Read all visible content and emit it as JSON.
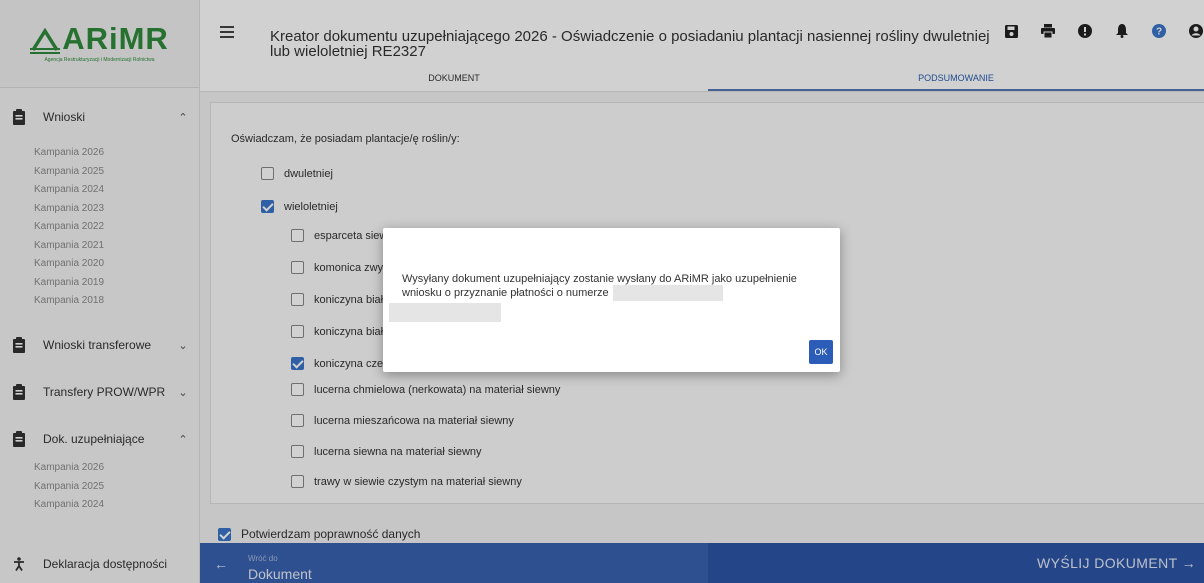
{
  "logo": {
    "text": "ARiMR",
    "subtitle": "Agencja Restrukturyzacji i Modernizacji Rolnictwa"
  },
  "header": {
    "title": "Kreator dokumentu uzupełniającego 2026 - Oświadczenie o posiadaniu plantacji nasiennej rośliny dwuletniej lub wieloletniej RE2327",
    "tabs": [
      "DOKUMENT",
      "PODSUMOWANIE"
    ],
    "icons": [
      "save-icon",
      "print-icon",
      "info-icon",
      "bell-icon",
      "help-icon",
      "user-icon"
    ]
  },
  "sidebar": {
    "sections": [
      {
        "label": "Wnioski",
        "chevron": "^",
        "items": [
          "Kampania 2026",
          "Kampania 2025",
          "Kampania 2024",
          "Kampania 2023",
          "Kampania 2022",
          "Kampania 2021",
          "Kampania 2020",
          "Kampania 2019",
          "Kampania 2018"
        ]
      },
      {
        "label": "Wnioski transferowe",
        "chevron": "v",
        "items": []
      },
      {
        "label": "Transfery PROW/WPR",
        "chevron": "v",
        "items": []
      },
      {
        "label": "Dok. uzupełniające",
        "chevron": "^",
        "items": [
          "Kampania 2026",
          "Kampania 2025",
          "Kampania 2024"
        ]
      }
    ],
    "footer": "Deklaracja dostępności"
  },
  "form": {
    "lead": "Oświadczam, że posiadam plantacje/ę roślin/y:",
    "types": [
      {
        "label": "dwuletniej",
        "checked": false
      },
      {
        "label": "wieloletniej",
        "checked": true
      }
    ],
    "plants": [
      {
        "label": "esparceta siewna na materiał siewny",
        "checked": false
      },
      {
        "label": "komonica zwyczajna na materiał siewny",
        "checked": false
      },
      {
        "label": "koniczyna białoróżowa (szwedzka) na materiał siewny",
        "checked": false
      },
      {
        "label": "koniczyna biała na materiał siewny",
        "checked": false
      },
      {
        "label": "koniczyna czerwona na materiał siewny",
        "checked": true
      },
      {
        "label": "lucerna chmielowa (nerkowata) na materiał siewny",
        "checked": false
      },
      {
        "label": "lucerna mieszańcowa na materiał siewny",
        "checked": false
      },
      {
        "label": "lucerna siewna na materiał siewny",
        "checked": false
      },
      {
        "label": "trawy w siewie czystym na materiał siewny",
        "checked": false
      }
    ],
    "confirm": {
      "label": "Potwierdzam poprawność danych",
      "checked": true
    }
  },
  "bottom": {
    "back_small": "Wróć do",
    "back_big": "Dokument",
    "send": "WYŚLIJ DOKUMENT"
  },
  "dialog": {
    "message": "Wysyłany dokument uzupełniający zostanie wysłany do ARiMR jako uzupełnienie wniosku o przyznanie płatności o numerze",
    "ok": "OK"
  },
  "colors": {
    "brand_green": "#2f8a3a",
    "primary_blue": "#2d56a6",
    "checkbox_blue": "#3a74c8"
  }
}
